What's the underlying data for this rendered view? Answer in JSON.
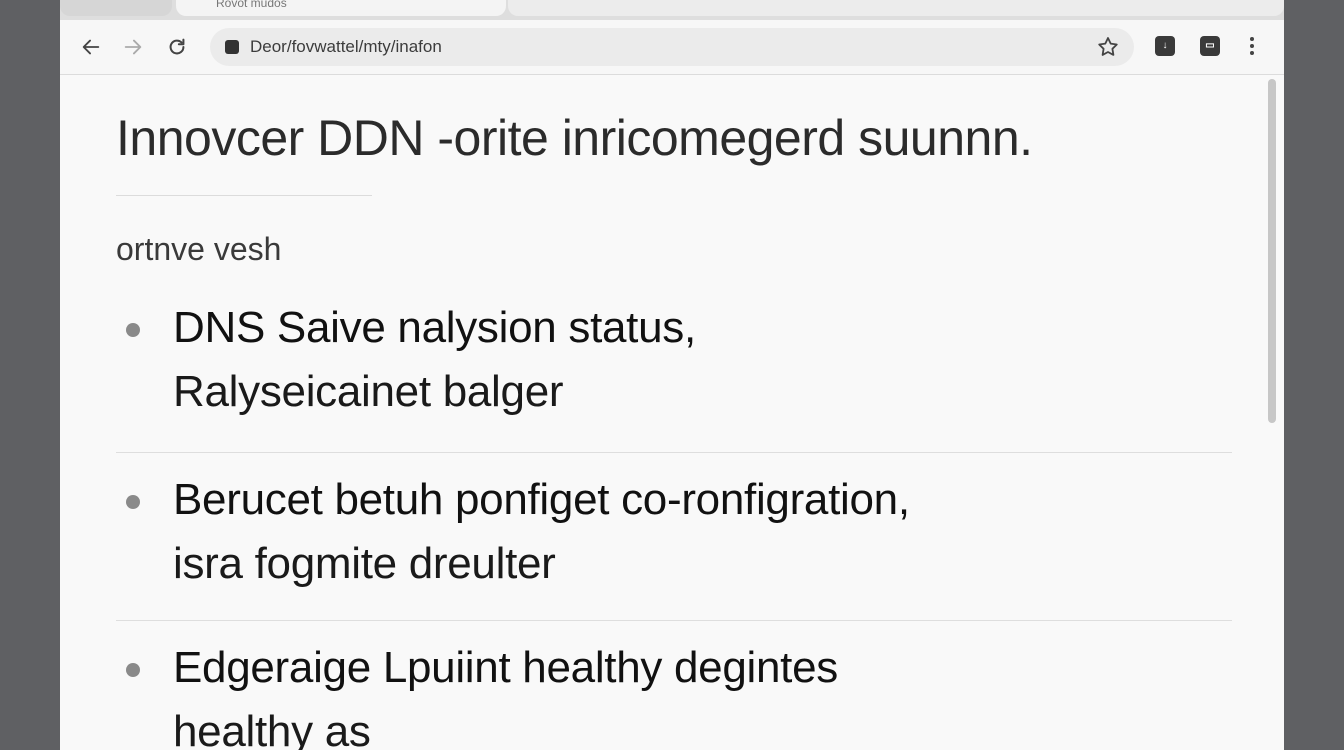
{
  "browser": {
    "tab_title": "Rovot mudos",
    "url": "Deor/fovwattel/mty/inafon"
  },
  "page": {
    "title": "Innovcer DDN -orite inricomegerd suunnn.",
    "section_label": "ortnve vesh",
    "items": [
      {
        "line1": "DNS Saive nalysion status,",
        "line2": "Ralyseicainet balger"
      },
      {
        "line1": "Berucet betuh ponfiget co-ronfigration,",
        "line2": "isra fogmite dreulter"
      },
      {
        "line1": "Edgeraige Lpuiint healthy degintes",
        "line2": "healthy as"
      }
    ]
  },
  "icons": {
    "back": "arrow-left-icon",
    "forward": "arrow-right-icon",
    "reload": "reload-icon",
    "bookmark": "star-icon",
    "menu": "more-vert-icon"
  },
  "colors": {
    "window_bg": "#f6f6f6",
    "frame": "#5f6063",
    "text": "#111111",
    "bullet": "#8a8a8a"
  }
}
